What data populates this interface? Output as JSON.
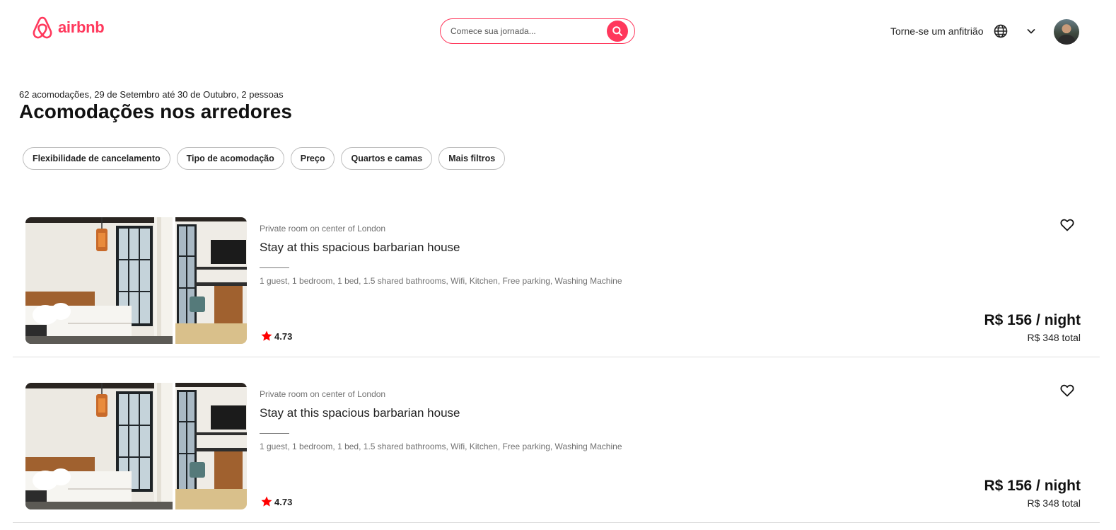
{
  "header": {
    "logo_text": "airbnb",
    "search": {
      "placeholder": "Comece sua jornada..."
    },
    "host_link": "Torne-se um anfitrião",
    "icons": [
      "airbnb-logo-icon",
      "search-icon",
      "globe-icon",
      "chevron-down-icon",
      "avatar"
    ],
    "brand_color": "#FF385C"
  },
  "results": {
    "summary": "62 acomodações, 29 de Setembro até 30 de Outubro, 2 pessoas",
    "title": "Acomodações nos arredores"
  },
  "filters": [
    {
      "label": "Flexibilidade de cancelamento"
    },
    {
      "label": "Tipo de acomodação"
    },
    {
      "label": "Preço"
    },
    {
      "label": "Quartos e camas"
    },
    {
      "label": "Mais filtros"
    }
  ],
  "listings": [
    {
      "type": "Private room on center of London",
      "title": "Stay at this spacious barbarian house",
      "amenities": "1 guest, 1 bedroom, 1 bed, 1.5 shared bathrooms, Wifi, Kitchen, Free parking, Washing Machine",
      "rating": "4.73",
      "price": "R$ 156 / night",
      "total": "R$ 348 total"
    },
    {
      "type": "Private room on center of London",
      "title": "Stay at this spacious barbarian house",
      "amenities": "1 guest, 1 bedroom, 1 bed, 1.5 shared bathrooms, Wifi, Kitchen, Free parking, Washing Machine",
      "rating": "4.73",
      "price": "R$ 156 / night",
      "total": "R$ 348 total"
    }
  ],
  "colors": {
    "star": "#FF0000",
    "accent": "#FF385C"
  }
}
